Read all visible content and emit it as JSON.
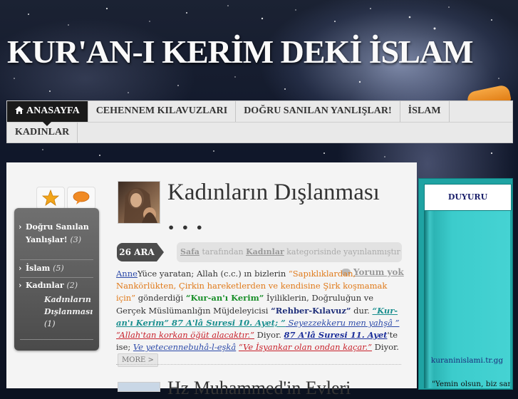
{
  "site": {
    "title": "KUR'AN-I KERİM DEKİ İSLAM"
  },
  "nav": {
    "row1": [
      {
        "label": "ANASAYFA",
        "active": true
      },
      {
        "label": "CEHENNEM KILAVUZLARI"
      },
      {
        "label": "DOĞRU SANILAN YANLIŞLAR!"
      },
      {
        "label": "İSLAM"
      }
    ],
    "row2": [
      {
        "label": "KADINLAR"
      }
    ]
  },
  "sidebar": {
    "items": [
      {
        "label": "Doğru Sanılan Yanlışlar!",
        "count": "(3)"
      },
      {
        "label": "İslam",
        "count": "(5)"
      },
      {
        "label": "Kadınlar",
        "count": "(2)"
      }
    ],
    "sub": {
      "label": "Kadınların Dışlanması",
      "count": "(1)"
    }
  },
  "post": {
    "title": "Kadınların Dışlanması",
    "dots": "• • •",
    "date": "26 ARA",
    "author": "Safa",
    "meta_mid": "tarafından",
    "category": "Kadınlar",
    "meta_end": "kategorisinde yayınlanmıştır",
    "comments": "Yorum yok",
    "body": {
      "p1": "Anne",
      "p2": "Yüce yaratan; Allah (c.c.) ın bizlerin ",
      "p3": "“Sapıklıklardan, Nankörlükten, Çirkin hareketlerden ve kendisine Şirk koşmamak için”",
      "p4": " gönderdiği ",
      "p5": "“Kur-an'ı Kerim”",
      "p6": " İyiliklerin, Doğruluğun ve Gerçek Müslümanlığın Müjdeleyicisi ",
      "p7": "“Rehber-Kılavuz”",
      "p8": " dur. ",
      "p9": "“Kur-an'ı Kerim” 87 A'lâ Suresi 10. Ayet; ”",
      "p10": " Seyezzekkeru men yahşâ ” ",
      "p11": "“Allah'tan korkan öğüt alacaktır.”",
      "p12": " Diyor. ",
      "p13": "87 A'lâ Suresi 11. Ayet",
      "p14": "'te ise; ",
      "p15": "Ve yetecennebuhâ-l-eşkâ",
      "p16": " ",
      "p17": "“Ve İsyankar olan ondan kaçar.”",
      "p18": " Diyor.",
      "more": "MORE >"
    }
  },
  "next_post": {
    "title": "Hz Muhammed'in Evleri"
  },
  "panel": {
    "title": "DUYURU PANOMUZ",
    "link": "kuraninislami.tr.gg",
    "quote": "\"Yemin olsun, biz sana"
  }
}
